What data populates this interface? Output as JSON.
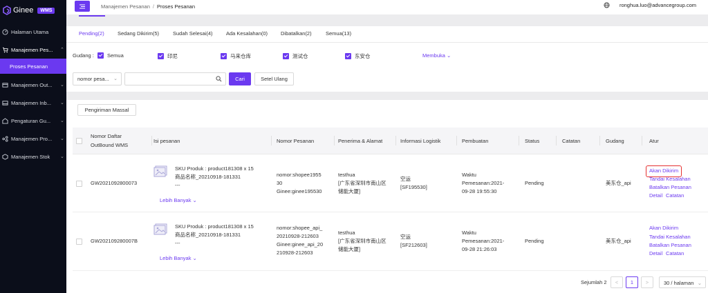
{
  "app": {
    "name": "Ginee",
    "badge": "WMS"
  },
  "sidebar": {
    "items": [
      {
        "label": "Halaman Utama",
        "icon": "dashboard-icon",
        "chevron": ""
      },
      {
        "label": "Manajemen Pes...",
        "icon": "cart-icon",
        "chevron": "^"
      },
      {
        "label": "Manajemen Out...",
        "icon": "outbound-icon",
        "chevron": "v"
      },
      {
        "label": "Manajemen Inb...",
        "icon": "inbound-icon",
        "chevron": "v"
      },
      {
        "label": "Pengaturan Gu...",
        "icon": "settings-icon",
        "chevron": "v"
      },
      {
        "label": "Manajemen Pro...",
        "icon": "product-icon",
        "chevron": "v"
      },
      {
        "label": "Manajemen Stok",
        "icon": "stock-icon",
        "chevron": "v"
      }
    ],
    "active_sub": "Proses Pesanan"
  },
  "topbar": {
    "breadcrumb_parent": "Manajemen Pesanan",
    "breadcrumb_sep": "/",
    "breadcrumb_current": "Proses Pesanan",
    "user_email": "ronghua.luo@advancegroup.com"
  },
  "tabs": [
    "Pending(2)",
    "Sedang Dikirim(5)",
    "Sudah Selesai(4)",
    "Ada Kesalahan(0)",
    "Dibatalkan(2)",
    "Semua(13)"
  ],
  "warehouse_filter": {
    "label": "Gudang :",
    "options": [
      {
        "label": "Semua",
        "checked": true
      },
      {
        "label": "印尼",
        "checked": true
      },
      {
        "label": "马来仓库",
        "checked": true
      },
      {
        "label": "测试仓",
        "checked": true
      },
      {
        "label": "东安仓",
        "checked": true
      }
    ],
    "expand": "Membuka"
  },
  "search": {
    "field_select": "nomor pesa...",
    "input_value": "",
    "search_button": "Cari",
    "reset_button": "Setel Ulang"
  },
  "bulk_ship_button": "Pengiriman Massal",
  "table": {
    "headers": {
      "outbound_line1": "Nomor Daftar",
      "outbound_line2": "OutBound WMS",
      "content": "Isi pesanan",
      "order_no": "Nomor Pesanan",
      "recipient": "Penerima & Alamat",
      "logistics": "Informasi Logistik",
      "created": "Pembuatan",
      "status": "Status",
      "notes": "Catatan",
      "warehouse": "Gudang",
      "actions": "Atur"
    },
    "rows": [
      {
        "outbound_no": "GW2021092800073",
        "sku_line": "SKU Produk : product181308 x 15",
        "product_name": "商品名称_20210918-181331",
        "extra": "---",
        "more": "Lebih Banyak",
        "order_l1": "nomor:shopee1955",
        "order_l2": "30",
        "order_l3": "Ginee:ginee195530",
        "recipient_name": "testhua",
        "addr_l1": "[广东省深圳市南山区",
        "addr_l2": "储能大厦]",
        "logistics_l1": "空运",
        "logistics_l2": "[SF195530]",
        "created_l1": "Waktu",
        "created_l2": "Pemesanan:2021-",
        "created_l3": "09-28 19:55:30",
        "status": "Pending",
        "warehouse": "美东仓_api",
        "actions": [
          "Akan Dikirim",
          "Tandai Kesalahan",
          "Batalkan Pesanan",
          "Detail",
          "Catatan"
        ]
      },
      {
        "outbound_no": "GW202109280007B",
        "sku_line": "SKU Produk : product181308 x 15",
        "product_name": "商品名称_20210918-181331",
        "extra": "---",
        "more": "Lebih Banyak",
        "order_l1": "nomor:shopee_api_",
        "order_l2": "20210928-212603",
        "order_l3": "Ginee:ginee_api_20",
        "order_l4": "210928-212603",
        "recipient_name": "testhua",
        "addr_l1": "[广东省深圳市南山区",
        "addr_l2": "储能大厦]",
        "logistics_l1": "空运",
        "logistics_l2": "[SF212603]",
        "created_l1": "Waktu",
        "created_l2": "Pemesanan:2021-",
        "created_l3": "09-28 21:26:03",
        "status": "Pending",
        "warehouse": "美东仓_api",
        "actions": [
          "Akan Dikirim",
          "Tandai Kesalahan",
          "Batalkan Pesanan",
          "Detail",
          "Catatan"
        ]
      }
    ]
  },
  "pagination": {
    "total_text": "Sejumlah 2",
    "prev": "<",
    "current_page": "1",
    "next": ">",
    "page_size": "30 / halaman"
  },
  "colors": {
    "primary": "#6b39f0",
    "sidebar_bg": "#0b0e1a",
    "highlight_border": "#e53030"
  }
}
